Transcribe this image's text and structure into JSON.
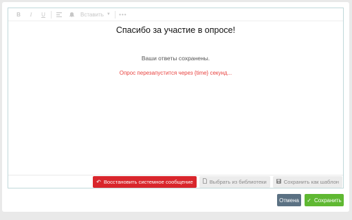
{
  "toolbar": {
    "bold_icon": "B",
    "italic_icon": "I",
    "underline_icon": "U",
    "insert_label": "Вставить",
    "more_icon": "•••"
  },
  "content": {
    "title": "Спасибо за участие в опросе!",
    "saved_text": "Ваши ответы сохранены.",
    "restart_text": "Опрос перезапустится через {time} секунд..."
  },
  "editor_actions": {
    "restore_label": "Восстановить системное сообщение",
    "library_label": "Выбрать из библиотеки",
    "template_label": "Сохранить как шаблон"
  },
  "footer": {
    "cancel_label": "Отмена",
    "save_label": "Сохранить"
  },
  "colors": {
    "restore": "#d9262c",
    "save": "#5fb832",
    "cancel": "#5b7183",
    "warning_text": "#e8423f"
  }
}
